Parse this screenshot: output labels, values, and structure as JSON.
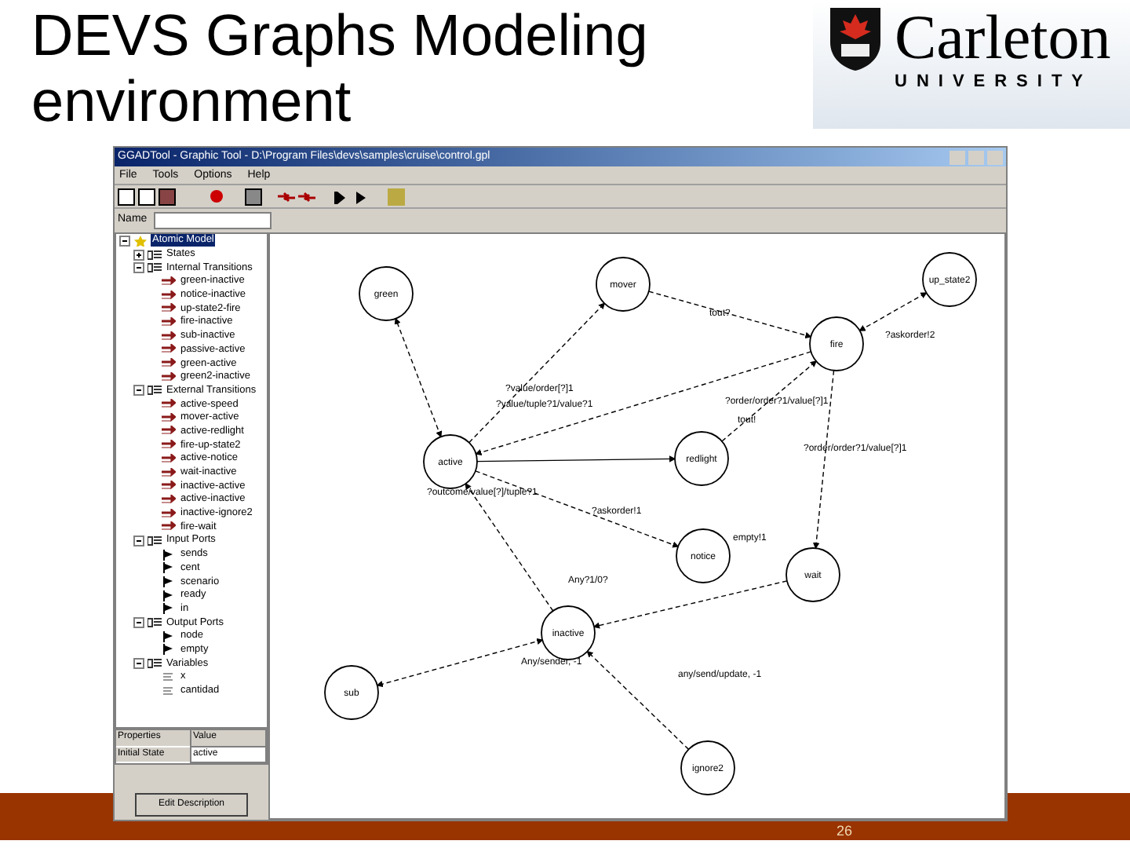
{
  "slide": {
    "title": "DEVS Graphs Modeling environment",
    "page_number": "26"
  },
  "logo": {
    "name": "Carleton",
    "subtitle": "UNIVERSITY"
  },
  "app": {
    "window_title": "GGADTool - Graphic Tool - D:\\Program Files\\devs\\samples\\cruise\\control.gpl",
    "menu": [
      "File",
      "Tools",
      "Options",
      "Help"
    ],
    "name_label": "Name",
    "tree": [
      {
        "label": "Atomic Model",
        "expanded": true,
        "selected": true,
        "kind": "model",
        "children": [
          {
            "label": "States",
            "expanded": false,
            "selected": false,
            "kind": "group"
          },
          {
            "label": "Internal Transitions",
            "expanded": true,
            "selected": false,
            "kind": "group",
            "children": [
              {
                "label": "green-inactive",
                "kind": "transition"
              },
              {
                "label": "notice-inactive",
                "kind": "transition"
              },
              {
                "label": "up-state2-fire",
                "kind": "transition"
              },
              {
                "label": "fire-inactive",
                "kind": "transition"
              },
              {
                "label": "sub-inactive",
                "kind": "transition"
              },
              {
                "label": "passive-active",
                "kind": "transition"
              },
              {
                "label": "green-active",
                "kind": "transition"
              },
              {
                "label": "green2-inactive",
                "kind": "transition"
              }
            ]
          },
          {
            "label": "External Transitions",
            "expanded": true,
            "selected": false,
            "kind": "group",
            "children": [
              {
                "label": "active-speed",
                "kind": "transition"
              },
              {
                "label": "mover-active",
                "kind": "transition"
              },
              {
                "label": "active-redlight",
                "kind": "transition"
              },
              {
                "label": "fire-up-state2",
                "kind": "transition"
              },
              {
                "label": "active-notice",
                "kind": "transition"
              },
              {
                "label": "wait-inactive",
                "kind": "transition"
              },
              {
                "label": "inactive-active",
                "kind": "transition"
              },
              {
                "label": "active-inactive",
                "kind": "transition"
              },
              {
                "label": "inactive-ignore2",
                "kind": "transition"
              },
              {
                "label": "fire-wait",
                "kind": "transition"
              }
            ]
          },
          {
            "label": "Input Ports",
            "expanded": true,
            "selected": false,
            "kind": "group",
            "children": [
              {
                "label": "sends",
                "kind": "port"
              },
              {
                "label": "cent",
                "kind": "port"
              },
              {
                "label": "scenario",
                "kind": "port"
              },
              {
                "label": "ready",
                "kind": "port"
              },
              {
                "label": "in",
                "kind": "port"
              }
            ]
          },
          {
            "label": "Output Ports",
            "expanded": true,
            "selected": false,
            "kind": "group",
            "children": [
              {
                "label": "node",
                "kind": "port"
              },
              {
                "label": "empty",
                "kind": "port"
              }
            ]
          },
          {
            "label": "Variables",
            "expanded": true,
            "selected": false,
            "kind": "group",
            "children": [
              {
                "label": "x",
                "kind": "variable"
              },
              {
                "label": "cantidad",
                "kind": "variable"
              }
            ]
          }
        ]
      }
    ],
    "properties": {
      "columns": [
        "Properties",
        "Value"
      ],
      "rows": [
        {
          "property": "Initial State",
          "value": "active"
        }
      ]
    },
    "button": "Edit Description",
    "diagram": {
      "nodes": [
        "green",
        "mover",
        "up_state2",
        "fire",
        "active",
        "redlight",
        "notice",
        "wait",
        "inactive",
        "sub",
        "ignore2"
      ],
      "transition_labels": [
        "?value/order[?]1",
        "?value/tuple?1/value?1",
        "tout?",
        "?askorder!2",
        "?order/order?1/value[?]1",
        "?outcome/value[?]/tuple?1",
        "tout!",
        "?askorder!1",
        "?order/order?1/value[?]1",
        "empty!1",
        "Any?1/0?",
        "Any/sender, -1",
        "any/send/update, -1"
      ]
    }
  }
}
